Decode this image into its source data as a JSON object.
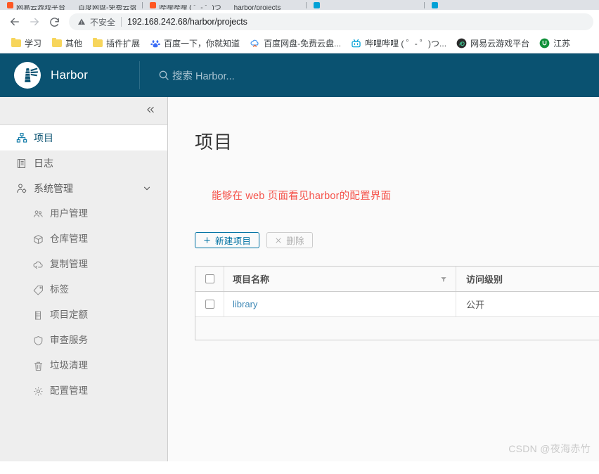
{
  "browser": {
    "tabs": [
      {
        "title": "网易云游戏平台",
        "favicon": "#ff5722",
        "active": false
      },
      {
        "title": "百度网盘-免费云盘",
        "favicon": "#4e6ef2",
        "active": false
      },
      {
        "title": "哔哩哔哩 ( ゜- ゜)つ",
        "favicon": "#00a1d6",
        "active": true
      },
      {
        "title": "harbor/projects",
        "favicon": "#00a1d6",
        "active": false
      }
    ],
    "nav": {
      "back_label": "←",
      "forward_label": "→",
      "reload_label": "⟳"
    },
    "omnibox": {
      "warning_icon": "warning-triangle-icon",
      "security_text": "不安全",
      "url": "192.168.242.68/harbor/projects"
    },
    "bookmarks": [
      {
        "label": "学习",
        "icon": "folder-icon",
        "color": "#f7d55b"
      },
      {
        "label": "其他",
        "icon": "folder-icon",
        "color": "#f7d55b"
      },
      {
        "label": "插件扩展",
        "icon": "folder-icon",
        "color": "#f7d55b"
      },
      {
        "label": "百度一下，你就知道",
        "icon": "baidu-paw-icon",
        "color": "#3b6cf5"
      },
      {
        "label": "百度网盘-免费云盘...",
        "icon": "baidu-pan-icon",
        "color": "#4e9bf0"
      },
      {
        "label": "哔哩哔哩 ( ゜- ゜)つ...",
        "icon": "bilibili-icon",
        "color": "#00a1d6"
      },
      {
        "label": "网易云游戏平台",
        "icon": "netease-icon",
        "color": "#2b2b2b"
      },
      {
        "label": "江苏",
        "icon": "green-circle-icon",
        "color": "#11913a"
      }
    ]
  },
  "harbor": {
    "brand": {
      "logo_icon": "harbor-lighthouse-icon",
      "name": "Harbor"
    },
    "search": {
      "icon": "search-icon",
      "placeholder": "搜索 Harbor..."
    }
  },
  "sidebar": {
    "collapse_icon": "double-chevron-left-icon",
    "items": [
      {
        "label": "项目",
        "icon": "org-chart-icon",
        "active": true,
        "level": 1
      },
      {
        "label": "日志",
        "icon": "list-document-icon",
        "active": false,
        "level": 1
      },
      {
        "label": "系统管理",
        "icon": "user-settings-icon",
        "active": false,
        "level": 1,
        "expandable": true,
        "chevron": "chevron-down-icon"
      },
      {
        "label": "用户管理",
        "icon": "users-group-icon",
        "active": false,
        "level": 2
      },
      {
        "label": "仓库管理",
        "icon": "cube-icon",
        "active": false,
        "level": 2
      },
      {
        "label": "复制管理",
        "icon": "cloud-sync-icon",
        "active": false,
        "level": 2
      },
      {
        "label": "标签",
        "icon": "tag-icon",
        "active": false,
        "level": 2
      },
      {
        "label": "项目定额",
        "icon": "beaker-icon",
        "active": false,
        "level": 2
      },
      {
        "label": "审查服务",
        "icon": "shield-icon",
        "active": false,
        "level": 2
      },
      {
        "label": "垃圾清理",
        "icon": "trash-icon",
        "active": false,
        "level": 2
      },
      {
        "label": "配置管理",
        "icon": "gear-icon",
        "active": false,
        "level": 2
      }
    ]
  },
  "main": {
    "page_title": "项目",
    "annotation": "能够在  web  页面看见harbor的配置界面",
    "actions": {
      "new_project": {
        "label": "新建项目",
        "icon": "plus-icon"
      },
      "delete": {
        "label": "删除",
        "icon": "x-icon",
        "disabled": true
      }
    },
    "table": {
      "columns": [
        {
          "label": "项目名称",
          "sortable": true,
          "filter_icon": "filter-icon"
        },
        {
          "label": "访问级别",
          "sortable": false
        }
      ],
      "rows": [
        {
          "name": "library",
          "access": "公开"
        }
      ]
    }
  },
  "watermark": "CSDN @夜海赤竹",
  "colors": {
    "header_bg": "#0a5271",
    "sidebar_bg": "#eeeeee",
    "content_bg": "#fafafa",
    "accent": "#0072a3",
    "link": "#3c87b5",
    "annotation": "#f5544c"
  }
}
